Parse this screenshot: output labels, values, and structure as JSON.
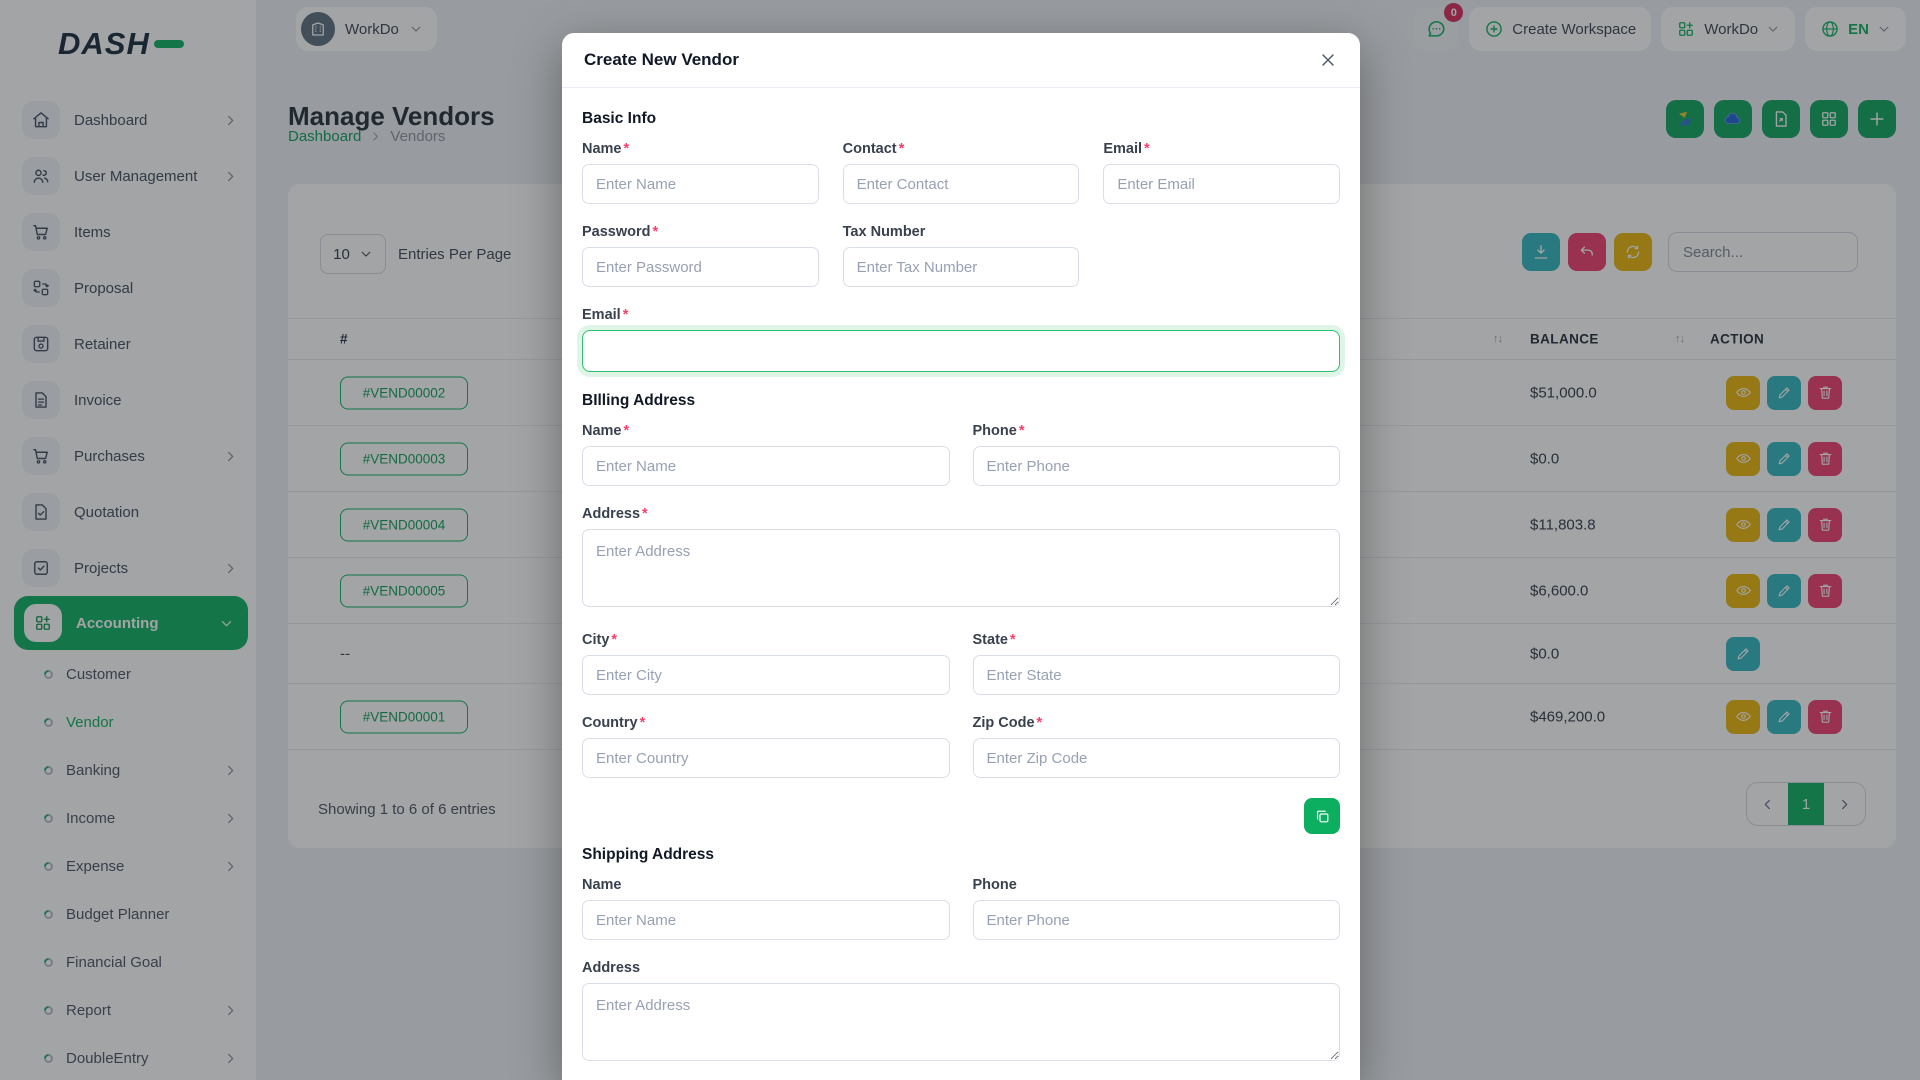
{
  "colors": {
    "primary": "#0caf60",
    "view_btn": "#eab308",
    "edit_btn": "#2fb5c2",
    "delete_btn": "#ef3a6d",
    "badge_red": "#d6295a"
  },
  "brand": {
    "name": "DASH"
  },
  "topbar": {
    "workspace_label": "WorkDo",
    "chat_badge": "0",
    "create_workspace_label": "Create Workspace",
    "workdo_menu_label": "WorkDo",
    "language_code": "EN"
  },
  "sidebar": {
    "items": [
      {
        "label": "Dashboard"
      },
      {
        "label": "User Management"
      },
      {
        "label": "Items"
      },
      {
        "label": "Proposal"
      },
      {
        "label": "Retainer"
      },
      {
        "label": "Invoice"
      },
      {
        "label": "Purchases"
      },
      {
        "label": "Quotation"
      },
      {
        "label": "Projects"
      },
      {
        "label": "Accounting"
      }
    ],
    "accounting_children": [
      {
        "label": "Customer"
      },
      {
        "label": "Vendor"
      },
      {
        "label": "Banking"
      },
      {
        "label": "Income"
      },
      {
        "label": "Expense"
      },
      {
        "label": "Budget Planner"
      },
      {
        "label": "Financial Goal"
      },
      {
        "label": "Report"
      },
      {
        "label": "DoubleEntry"
      }
    ]
  },
  "page": {
    "title": "Manage Vendors",
    "breadcrumb_home": "Dashboard",
    "breadcrumb_current": "Vendors"
  },
  "table_card": {
    "entries_value": "10",
    "entries_label": "Entries Per Page",
    "search_placeholder": "Search...",
    "sort_icon": "↑↓",
    "headers": {
      "col_id": "#",
      "balance": "BALANCE",
      "action": "ACTION"
    },
    "rows": [
      {
        "id": "#VEND00002",
        "balance": "$51,000.0"
      },
      {
        "id": "#VEND00003",
        "balance": "$0.0"
      },
      {
        "id": "#VEND00004",
        "balance": "$11,803.8"
      },
      {
        "id": "#VEND00005",
        "balance": "$6,600.0"
      },
      {
        "id": "--",
        "balance": "$0.0"
      },
      {
        "id": "#VEND00001",
        "balance": "$469,200.0"
      }
    ],
    "footer_text": "Showing 1 to 6 of 6 entries",
    "pagination_current": "1"
  },
  "modal": {
    "title": "Create New Vendor",
    "required_mark": "*",
    "sections": {
      "basic": "Basic Info",
      "billing": "BIlling Address",
      "shipping": "Shipping Address"
    },
    "fields": {
      "name": {
        "label": "Name",
        "placeholder": "Enter Name"
      },
      "contact": {
        "label": "Contact",
        "placeholder": "Enter Contact"
      },
      "email": {
        "label": "Email",
        "placeholder": "Enter Email"
      },
      "password": {
        "label": "Password",
        "placeholder": "Enter Password"
      },
      "tax_number": {
        "label": "Tax Number",
        "placeholder": "Enter Tax Number"
      },
      "email_main": {
        "label": "Email",
        "value": ""
      },
      "billing_name": {
        "label": "Name",
        "placeholder": "Enter Name"
      },
      "billing_phone": {
        "label": "Phone",
        "placeholder": "Enter Phone"
      },
      "billing_address": {
        "label": "Address",
        "placeholder": "Enter Address"
      },
      "city": {
        "label": "City",
        "placeholder": "Enter City"
      },
      "state": {
        "label": "State",
        "placeholder": "Enter State"
      },
      "country": {
        "label": "Country",
        "placeholder": "Enter Country"
      },
      "zip": {
        "label": "Zip Code",
        "placeholder": "Enter Zip Code"
      },
      "shipping_name": {
        "label": "Name",
        "placeholder": "Enter Name"
      },
      "shipping_phone": {
        "label": "Phone",
        "placeholder": "Enter Phone"
      },
      "shipping_address": {
        "label": "Address",
        "placeholder": "Enter Address"
      }
    }
  }
}
